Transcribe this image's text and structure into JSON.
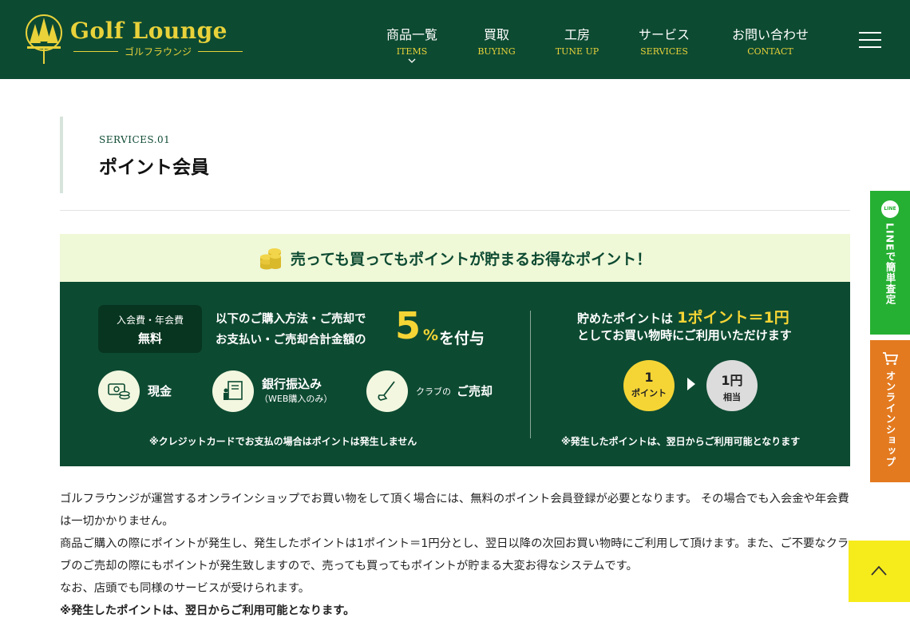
{
  "brand": {
    "title": "Golf Lounge",
    "subtitle": "ゴルフラウンジ",
    "accent": "#e9d23a",
    "primary": "#0d4a32"
  },
  "nav": {
    "items": [
      {
        "jp": "商品一覧",
        "en": "ITEMS",
        "has_dropdown": true
      },
      {
        "jp": "買取",
        "en": "BUYING"
      },
      {
        "jp": "工房",
        "en": "TUNE UP"
      },
      {
        "jp": "サービス",
        "en": "SERVICES"
      },
      {
        "jp": "お問い合わせ",
        "en": "CONTACT"
      }
    ],
    "menu_icon": "hamburger-icon"
  },
  "section": {
    "label": "SERVICES.01",
    "title": "ポイント会員"
  },
  "banner": {
    "headline": "売っても買ってもポイントが貯まるお得なポイント！",
    "badge_line1": "入会費・年会費",
    "badge_line2": "無料",
    "intro_line1": "以下のご購入方法・ご売却で",
    "intro_line2": "お支払い・ご売却合計金額の",
    "rate_number": "5",
    "rate_unit": "%",
    "rate_suffix": "を付与",
    "payments": {
      "cash": "現金",
      "bank": "銀行振込み",
      "bank_note": "（WEB購入のみ）",
      "club_prefix": "クラブの",
      "club_main": "ご売却"
    },
    "note_left": "※クレジットカードでお支払の場合はポイントは発生しません",
    "right_line1_prefix": "貯めたポイントは",
    "right_line1_value": "1ポイント＝1円",
    "right_line2": "としてお買い物時にご利用いただけます",
    "point_circle_number": "1",
    "point_circle_label": "ポイント",
    "yen_circle_number": "1円",
    "yen_circle_label": "相当",
    "note_right": "※発生したポイントは、翌日からご利用可能となります"
  },
  "body": {
    "p1": "ゴルフラウンジが運営するオンラインショップでお買い物をして頂く場合には、無料のポイント会員登録が必要となります。 その場合でも入会金や年会費は一切かかりません。",
    "p2": "商品ご購入の際にポイントが発生し、発生したポイントは1ポイント＝1円分とし、翌日以降の次回お買い物時にご利用して頂けます。また、ご不要なクラブのご売却の際にもポイントが発生致しますので、売っても買ってもポイントが貯まる大変お得なシステムです。",
    "p3": "なお、店頭でも同様のサービスが受けられます。",
    "p4": "※発生したポイントは、翌日からご利用可能となります。"
  },
  "side": {
    "line_badge": "LINE",
    "line_label": "LINEで簡単査定",
    "line_color": "#26b033",
    "shop_label": "オンラインショップ",
    "shop_color": "#e37a1f",
    "to_top_color": "#f7ec1b"
  }
}
